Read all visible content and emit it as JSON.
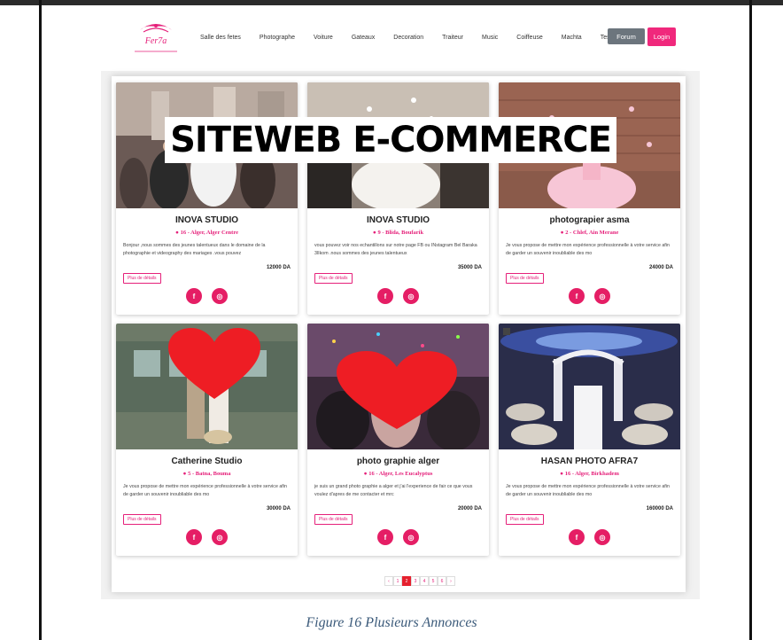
{
  "nav": {
    "links": [
      "Salle des fetes",
      "Photographe",
      "Voiture",
      "Gateaux",
      "Decoration",
      "Traiteur",
      "Music",
      "Coiffeuse",
      "Machta",
      "Tesdira"
    ],
    "forum_label": "Forum",
    "login_label": "Login",
    "brand_color": "#f0287c"
  },
  "overlay": {
    "title": "SITEWEB E-COMMERCE"
  },
  "cards": [
    {
      "title": "INOVA STUDIO",
      "location": "16 - Alger, Alger Centre",
      "description": "Bonjour ,nous sommes des jeunes talentueux dans le domaine de la photographie et videography des mariages .vous pouvez",
      "price": "12000 DA",
      "details_label": "Plus de détails"
    },
    {
      "title": "INOVA STUDIO",
      "location": "9 - Blida, Boufarik",
      "description": "vous pouvez voir nos echantillons sur notre page FB ou INstagram Bel Baraka 3lIkom .nous sommes des jeunes talentueux",
      "price": "35000 DA",
      "details_label": "Plus de détails"
    },
    {
      "title": "photograpier asma",
      "location": "2 - Chlef, Ain Merane",
      "description": "Je vous propose de mettre mon expérience professionnelle à votre service afin de garder un souvenir inoubliable des mo",
      "price": "24000 DA",
      "details_label": "Plus de détails"
    },
    {
      "title": "Catherine Studio",
      "location": "5 - Batna, Bouma",
      "description": "Je vous propose de mettre mon expérience professionnelle à votre service afin de garder un souvenir inoubliable des mo",
      "price": "30000 DA",
      "details_label": "Plus de détails"
    },
    {
      "title": "photo graphie alger",
      "location": "16 - Alger, Les Eucalyptus",
      "description": "je suis un grand photo graphie a alger et j'ai l'experience de fair ce que vous voulez d'apres de me contacter et mrc",
      "price": "20000 DA",
      "details_label": "Plus de détails"
    },
    {
      "title": "HASAN PHOTO AFRA7",
      "location": "16 - Alger, Birkhadem",
      "description": "Je vous propose de mettre mon expérience professionnelle à votre service afin de garder un souvenir inoubliable des mo",
      "price": "160000 DA",
      "details_label": "Plus de détails"
    }
  ],
  "social": {
    "facebook_glyph": "f",
    "instagram_glyph": "◎"
  },
  "pagination": {
    "prev": "‹",
    "pages": [
      "1",
      "2",
      "3",
      "4",
      "5",
      "6"
    ],
    "active": "2",
    "next": "›"
  },
  "caption": "Figure 16 Plusieurs Annonces"
}
